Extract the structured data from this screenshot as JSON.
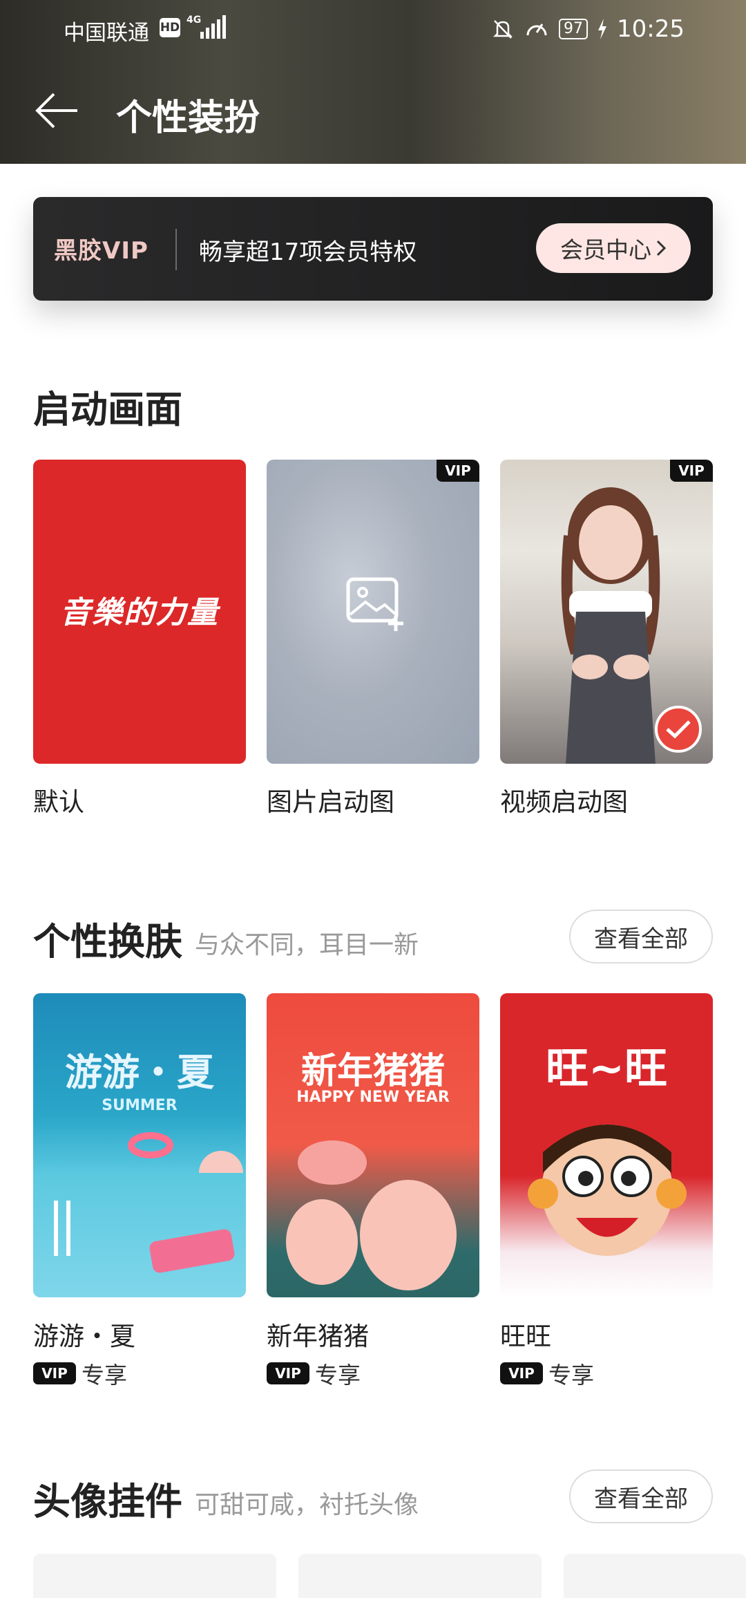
{
  "status_bar": {
    "carrier": "中国联通",
    "hd": "HD",
    "network": "4G",
    "battery": "97",
    "time": "10:25"
  },
  "header": {
    "title": "个性装扮"
  },
  "vip_banner": {
    "logo": "黑胶VIP",
    "text": "畅享超17项会员特权",
    "button": "会员中心"
  },
  "launch": {
    "title": "启动画面",
    "cards": [
      {
        "label": "默认",
        "slogan": "音樂的力量"
      },
      {
        "label": "图片启动图",
        "badge": "VIP"
      },
      {
        "label": "视频启动图",
        "badge": "VIP"
      }
    ]
  },
  "skins": {
    "title": "个性换肤",
    "subtitle": "与众不同，耳目一新",
    "view_all": "查看全部",
    "cards": [
      {
        "label": "游游・夏",
        "art_title": "游游・夏",
        "art_sub": "SUMMER",
        "badge": "VIP",
        "tag": "专享"
      },
      {
        "label": "新年猪猪",
        "art_title": "新年猪猪",
        "art_sub": "HAPPY NEW YEAR",
        "badge": "VIP",
        "tag": "专享"
      },
      {
        "label": "旺旺",
        "art_title": "旺~旺",
        "badge": "VIP",
        "tag": "专享"
      }
    ]
  },
  "avatar_pendants": {
    "title": "头像挂件",
    "subtitle": "可甜可咸，衬托头像",
    "view_all": "查看全部"
  },
  "colors": {
    "accent_red": "#dc2828",
    "vip_pink": "#fde6e3",
    "check_red": "#e9453c"
  }
}
